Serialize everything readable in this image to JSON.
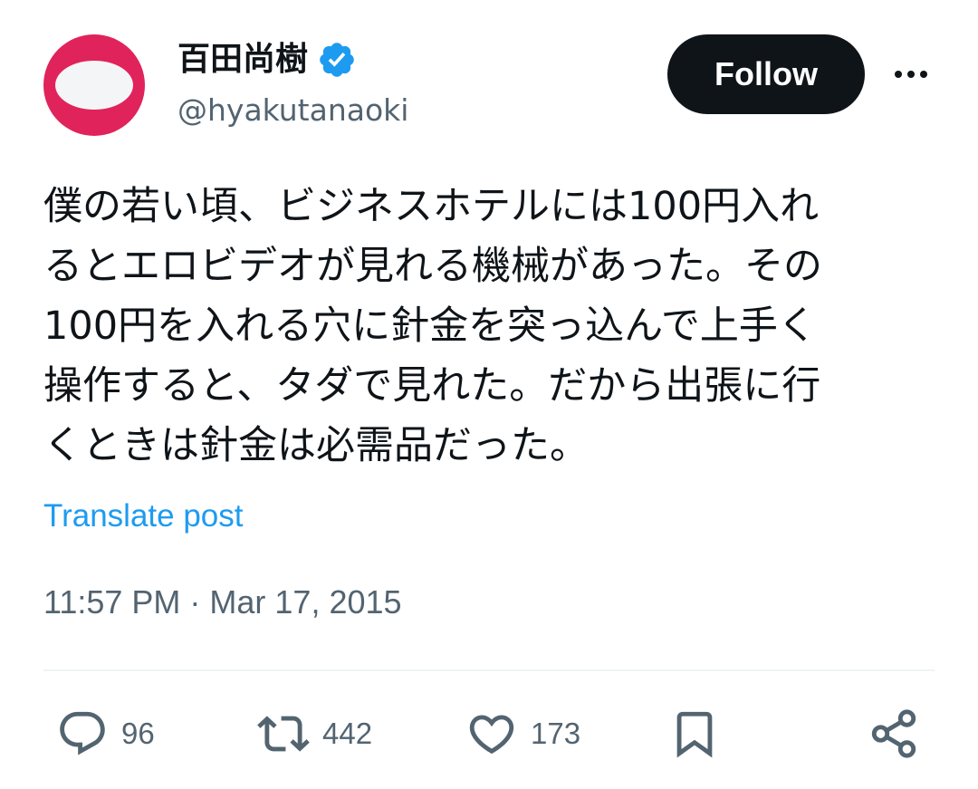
{
  "author": {
    "name": "百田尚樹",
    "handle": "@hyakutanaoki",
    "verified_icon": "verified-badge-icon",
    "avatar_color": "#e0235a"
  },
  "actions_top": {
    "follow_label": "Follow",
    "more_icon": "more-dots-icon"
  },
  "post": {
    "lines": [
      "僕の若い頃、ビジネスホテルには100円入れ",
      "るとエロビデオが見れる機械があった。その",
      "100円を入れる穴に針金を突っ込んで上手く",
      "操作すると、タダで見れた。だから出張に行",
      "くときは針金は必需品だった。"
    ],
    "translate_label": "Translate post",
    "timestamp": "11:57 PM · Mar 17, 2015"
  },
  "engagement": {
    "replies": "96",
    "reposts": "442",
    "likes": "173"
  },
  "colors": {
    "text": "#0f1419",
    "secondary": "#536471",
    "link": "#1d9bf0",
    "follow_bg": "#0f1419"
  }
}
